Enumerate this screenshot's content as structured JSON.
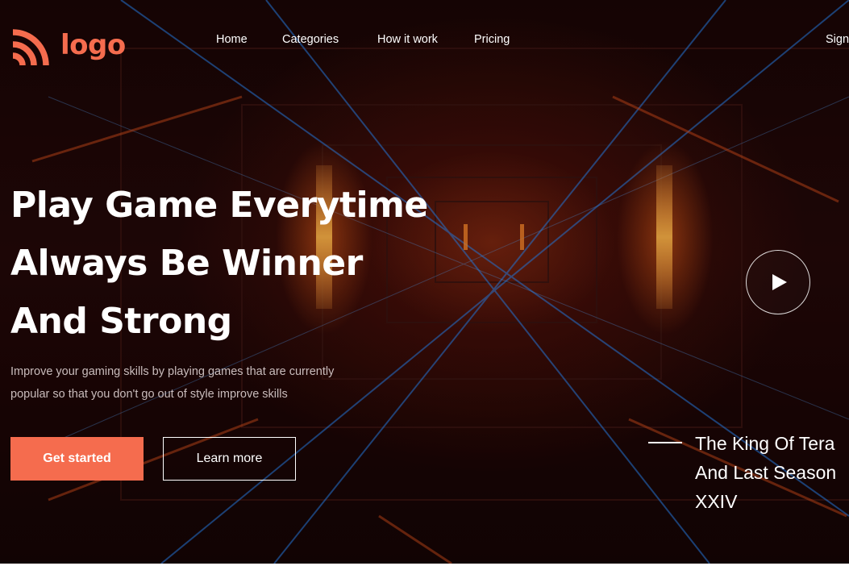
{
  "brand": {
    "logo_text": "logo",
    "accent_color": "#f56c4e",
    "logo_icon": "wifi-arcs-icon"
  },
  "nav": {
    "items": [
      {
        "label": "Home"
      },
      {
        "label": "Categories"
      },
      {
        "label": "How it work"
      },
      {
        "label": "Pricing"
      }
    ],
    "signin_label": "Sign"
  },
  "hero": {
    "headline": [
      "Play Game Everytime",
      "Always Be Winner",
      "And Strong"
    ],
    "subtext": [
      "Improve your gaming skills by playing games that are currently",
      "popular so that you don't go out of style improve skills"
    ],
    "primary_button": "Get started",
    "secondary_button": "Learn more",
    "play_icon": "play-icon",
    "feature_title": [
      "The King Of Tera",
      "And Last Season",
      "XXIV"
    ]
  }
}
